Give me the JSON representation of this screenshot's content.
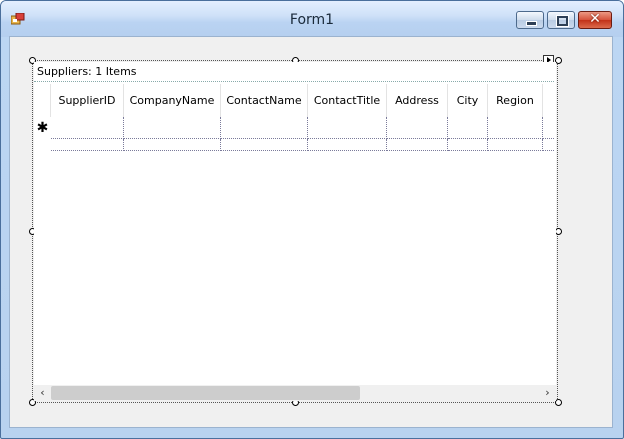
{
  "window": {
    "title": "Form1",
    "close_glyph": "✕"
  },
  "data_grid": {
    "caption": "Suppliers: 1 Items",
    "columns": [
      "SupplierID",
      "CompanyName",
      "ContactName",
      "ContactTitle",
      "Address",
      "City",
      "Region"
    ],
    "new_row_marker": "✱",
    "scroll_left": "‹",
    "scroll_right": "›"
  },
  "colors": {
    "title_bar": "#bad3f2",
    "client_area": "#f0f0f0",
    "grid_background": "#ffffff"
  }
}
